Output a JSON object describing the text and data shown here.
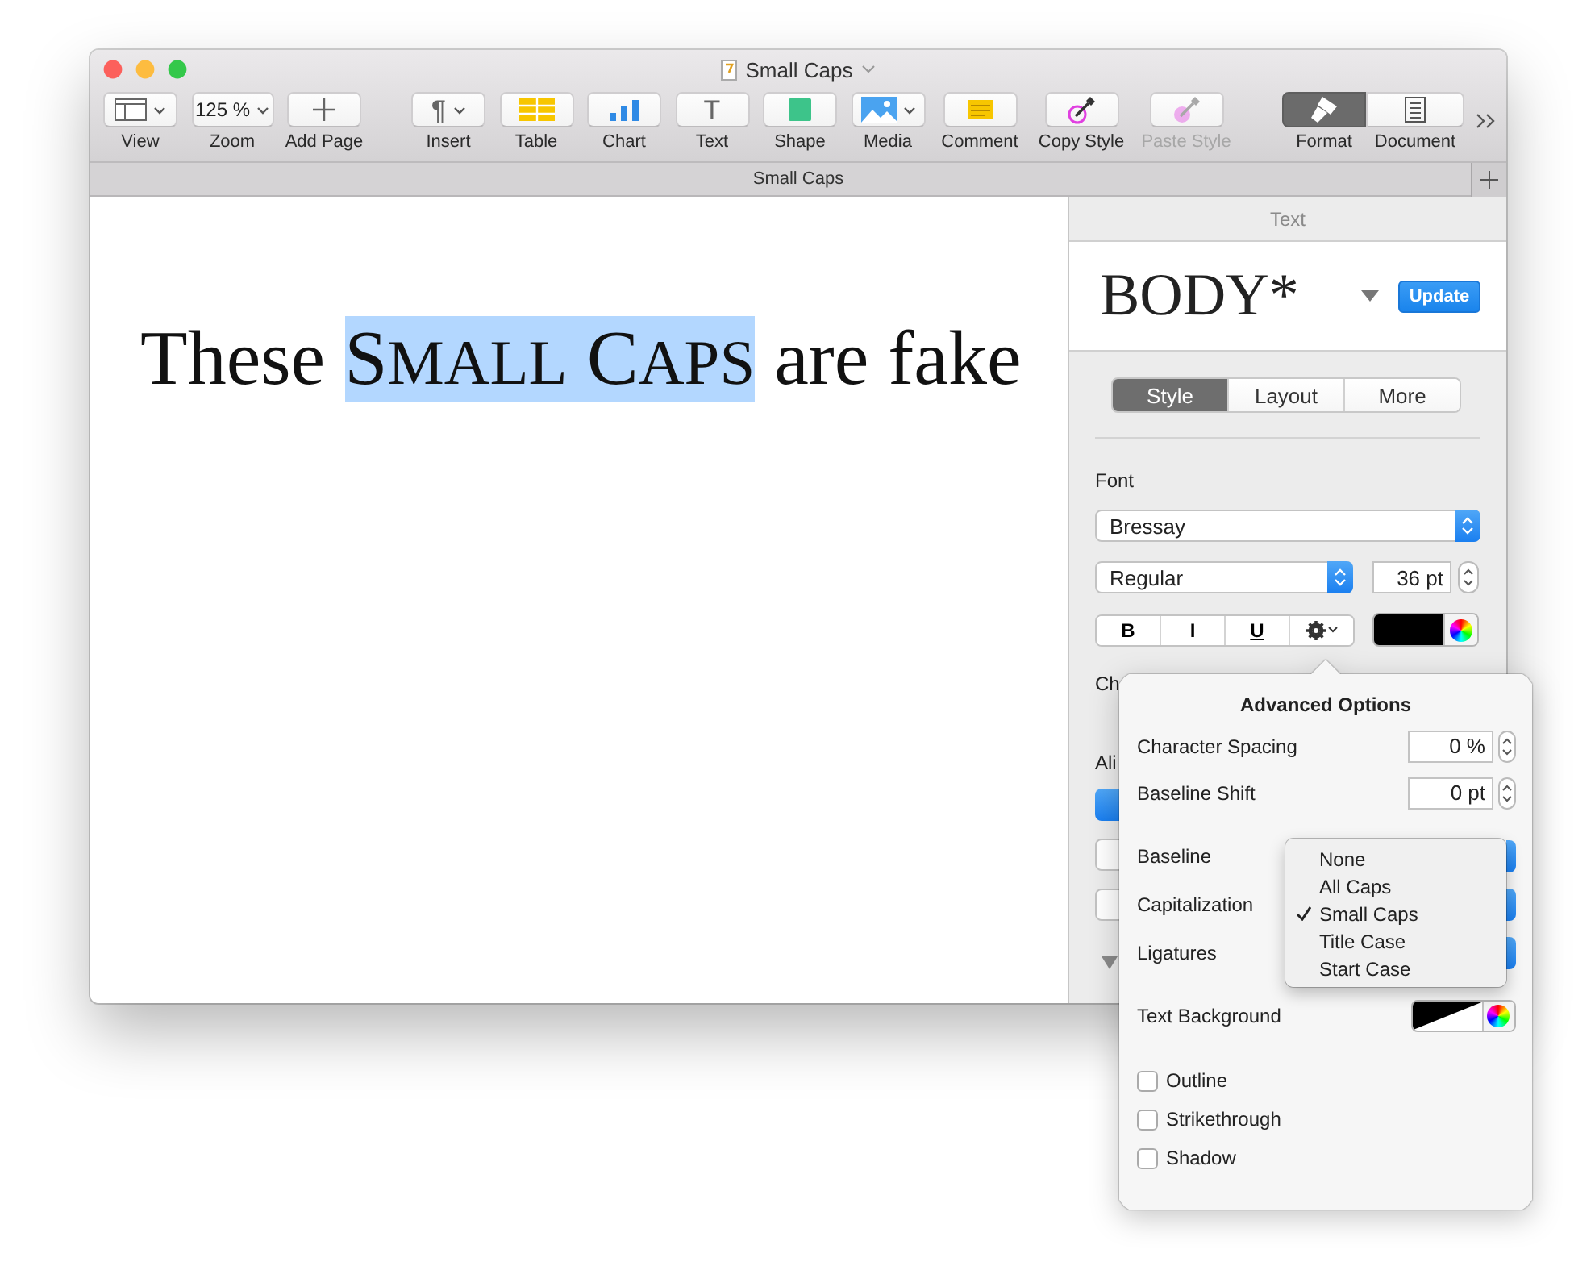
{
  "window": {
    "title": "Small Caps"
  },
  "toolbar": {
    "groups": [
      [
        {
          "kind": "view",
          "label": "View",
          "disabled": false
        },
        {
          "kind": "zoom",
          "label": "Zoom",
          "value": "125 %",
          "disabled": false
        },
        {
          "kind": "add",
          "label": "Add Page",
          "disabled": false
        }
      ],
      [
        {
          "kind": "insert",
          "label": "Insert",
          "glyph": "¶",
          "disabled": false
        },
        {
          "kind": "table",
          "label": "Table",
          "disabled": false
        },
        {
          "kind": "chart",
          "label": "Chart",
          "disabled": false
        },
        {
          "kind": "text",
          "label": "Text",
          "glyph": "T",
          "disabled": false
        },
        {
          "kind": "shape",
          "label": "Shape",
          "disabled": false
        },
        {
          "kind": "media",
          "label": "Media",
          "disabled": false
        }
      ],
      [
        {
          "kind": "comment",
          "label": "Comment",
          "disabled": false
        }
      ],
      [
        {
          "kind": "copystyle",
          "label": "Copy Style",
          "disabled": false
        },
        {
          "kind": "pastestyle",
          "label": "Paste Style",
          "disabled": true
        }
      ]
    ],
    "inspector_tabs": [
      {
        "kind": "format",
        "label": "Format",
        "selected": true
      },
      {
        "kind": "document",
        "label": "Document",
        "selected": false
      }
    ]
  },
  "tab_bar": {
    "title": "Small Caps"
  },
  "document": {
    "segments": [
      {
        "kind": "plain",
        "text": "These ",
        "selected": false
      },
      {
        "kind": "smallcaps",
        "text": "SMALL CAPS",
        "selected": true
      },
      {
        "kind": "plain",
        "text": " are fake",
        "selected": false
      }
    ]
  },
  "sidebar": {
    "header": "Text",
    "paragraph_style": "BODY*",
    "update_button": "Update",
    "tabs": [
      {
        "label": "Style",
        "selected": true
      },
      {
        "label": "Layout",
        "selected": false
      },
      {
        "label": "More",
        "selected": false
      }
    ],
    "font_label": "Font",
    "font_family": "Bressay",
    "typeface": "Regular",
    "size": "36 pt",
    "style_buttons": [
      {
        "kind": "bold",
        "label": "B"
      },
      {
        "kind": "italic",
        "label": "I"
      },
      {
        "kind": "underline",
        "label": "U"
      }
    ],
    "character_styles_label": "Ch",
    "alignment_label": "Ali"
  },
  "advanced_options": {
    "title": "Advanced Options",
    "fields": [
      {
        "label": "Character Spacing",
        "value": "0 %"
      },
      {
        "label": "Baseline Shift",
        "value": "0 pt"
      }
    ],
    "popups": [
      {
        "label": "Baseline"
      },
      {
        "label": "Capitalization"
      },
      {
        "label": "Ligatures"
      }
    ],
    "capitalization_menu": [
      {
        "label": "None",
        "selected": false
      },
      {
        "label": "All Caps",
        "selected": false
      },
      {
        "label": "Small Caps",
        "selected": true
      },
      {
        "label": "Title Case",
        "selected": false
      },
      {
        "label": "Start Case",
        "selected": false
      }
    ],
    "text_background_label": "Text Background",
    "checkboxes": [
      {
        "label": "Outline",
        "checked": false
      },
      {
        "label": "Strikethrough",
        "checked": false
      },
      {
        "label": "Shadow",
        "checked": false
      }
    ]
  }
}
